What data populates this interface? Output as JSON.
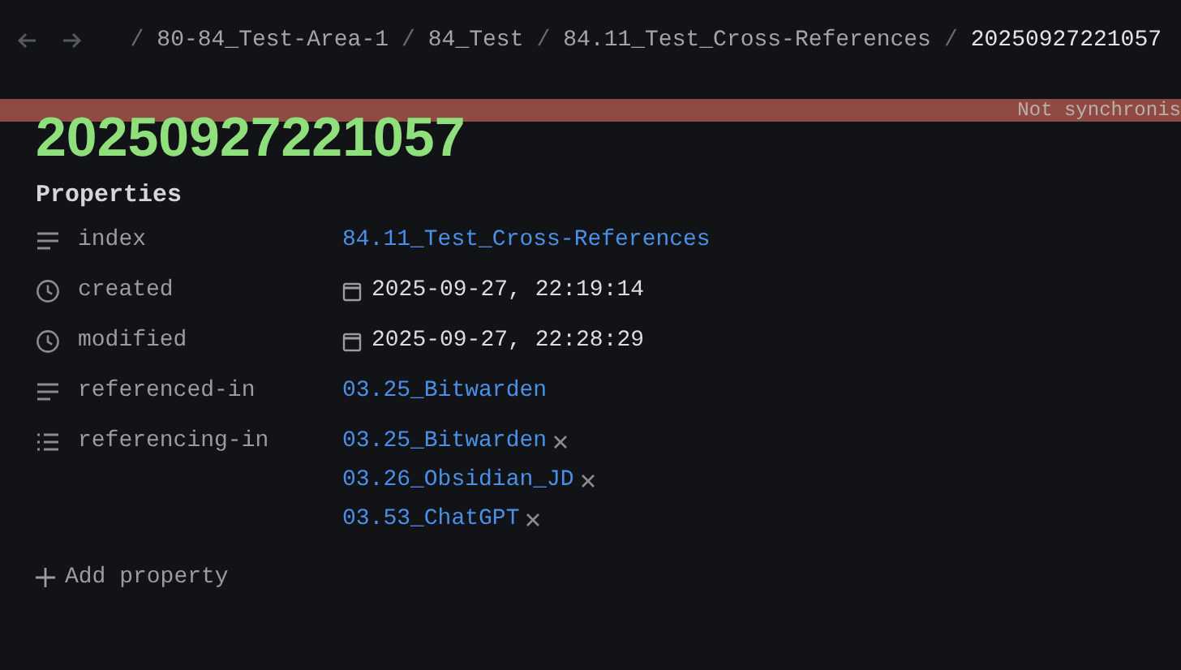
{
  "breadcrumb": [
    {
      "kind": "separator",
      "text": "/"
    },
    {
      "kind": "segment",
      "text": "80-84_Test-Area-1"
    },
    {
      "kind": "separator",
      "text": "/"
    },
    {
      "kind": "segment",
      "text": "84_Test"
    },
    {
      "kind": "separator",
      "text": "/"
    },
    {
      "kind": "segment",
      "text": "84.11_Test_Cross-References"
    },
    {
      "kind": "separator",
      "text": "/"
    },
    {
      "kind": "current",
      "text": "20250927221057"
    }
  ],
  "sync_banner": {
    "text": "Not synchronis"
  },
  "title": "20250927221057",
  "properties": {
    "heading": "Properties",
    "rows": [
      {
        "kind": "text",
        "name": "index",
        "values": [
          "84.11_Test_Cross-References"
        ]
      },
      {
        "kind": "date",
        "name": "created",
        "values": [
          "2025-09-27, 22:19:14"
        ]
      },
      {
        "kind": "date",
        "name": "modified",
        "values": [
          "2025-09-27, 22:28:29"
        ]
      },
      {
        "kind": "text",
        "name": "referenced-in",
        "values": [
          "03.25_Bitwarden"
        ]
      },
      {
        "kind": "list",
        "name": "referencing-in",
        "values": [
          "03.25_Bitwarden",
          "03.26_Obsidian_JD",
          "03.53_ChatGPT"
        ]
      }
    ],
    "add_label": "Add property"
  }
}
